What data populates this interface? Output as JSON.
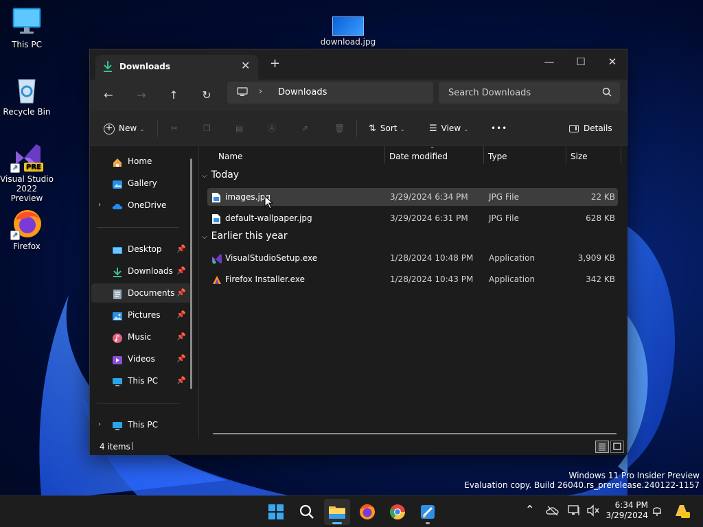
{
  "desktop": {
    "icons": [
      {
        "label": "This PC",
        "icon": "monitor-icon"
      },
      {
        "label": "Recycle Bin",
        "icon": "recycle-bin-icon"
      },
      {
        "label": "Visual Studio 2022 Preview",
        "icon": "visual-studio-icon",
        "badge": "PRE"
      },
      {
        "label": "Firefox",
        "icon": "firefox-icon"
      }
    ],
    "dragged_file": {
      "label": "download.jpg"
    }
  },
  "window": {
    "tab": {
      "title": "Downloads",
      "icon": "download-arrow-icon"
    },
    "controls": {
      "minimize": "—",
      "maximize": "☐",
      "close": "✕",
      "new_tab": "+",
      "tab_close": "✕"
    },
    "nav": {
      "back": "←",
      "forward": "→",
      "up": "↑",
      "refresh": "↻"
    },
    "address": {
      "separator": "›",
      "crumb": "Downloads"
    },
    "search": {
      "placeholder": "Search Downloads"
    },
    "commandbar": {
      "new_label": "New",
      "sort_label": "Sort",
      "view_label": "View",
      "more_label": "•••",
      "details_label": "Details"
    },
    "sidebar": {
      "top": [
        {
          "label": "Home",
          "icon": "home-icon"
        },
        {
          "label": "Gallery",
          "icon": "gallery-icon"
        },
        {
          "label": "OneDrive",
          "icon": "onedrive-cloud-icon",
          "expander": "›"
        }
      ],
      "quick": [
        {
          "label": "Desktop",
          "icon": "desktop-folder-icon",
          "pin": "📌"
        },
        {
          "label": "Downloads",
          "icon": "download-arrow-icon",
          "pin": "📌"
        },
        {
          "label": "Documents",
          "icon": "documents-icon",
          "pin": "📌"
        },
        {
          "label": "Pictures",
          "icon": "pictures-icon",
          "pin": "📌"
        },
        {
          "label": "Music",
          "icon": "music-icon",
          "pin": "📌"
        },
        {
          "label": "Videos",
          "icon": "videos-icon",
          "pin": "📌"
        },
        {
          "label": "This PC",
          "icon": "monitor-icon",
          "pin": "📌"
        }
      ],
      "bottom": [
        {
          "label": "This PC",
          "icon": "monitor-icon",
          "expander": "›"
        }
      ]
    },
    "columns": {
      "name": "Name",
      "date": "Date modified",
      "type": "Type",
      "size": "Size"
    },
    "groups": [
      {
        "label": "Today",
        "chevron": "⌵",
        "files": [
          {
            "name": "images.jpg",
            "date": "3/29/2024 6:34 PM",
            "type": "JPG File",
            "size": "22 KB",
            "icon": "jpg-file-icon"
          },
          {
            "name": "default-wallpaper.jpg",
            "date": "3/29/2024 6:31 PM",
            "type": "JPG File",
            "size": "628 KB",
            "icon": "jpg-file-icon"
          }
        ]
      },
      {
        "label": "Earlier this year",
        "chevron": "⌵",
        "files": [
          {
            "name": "VisualStudioSetup.exe",
            "date": "1/28/2024 10:48 PM",
            "type": "Application",
            "size": "3,909 KB",
            "icon": "visual-studio-icon"
          },
          {
            "name": "Firefox Installer.exe",
            "date": "1/28/2024 10:43 PM",
            "type": "Application",
            "size": "342 KB",
            "icon": "firefox-installer-icon"
          }
        ]
      }
    ],
    "status": {
      "items_count": "4 items"
    }
  },
  "watermark": {
    "line1": "Windows 11 Pro Insider Preview",
    "line2": "Evaluation copy. Build 26040.rs_prerelease.240122-1157"
  },
  "taskbar": {
    "apps": [
      "windows-start-icon",
      "search-icon",
      "file-explorer-icon",
      "firefox-icon",
      "chrome-icon",
      "paint-icon"
    ],
    "tray": {
      "chevron": "⌃"
    },
    "clock": {
      "time": "6:34 PM",
      "date": "3/29/2024"
    }
  },
  "colors": {
    "accent": "#4cc2ff",
    "window_bg": "#1c1c1c",
    "selection": "#3d3d3d"
  }
}
